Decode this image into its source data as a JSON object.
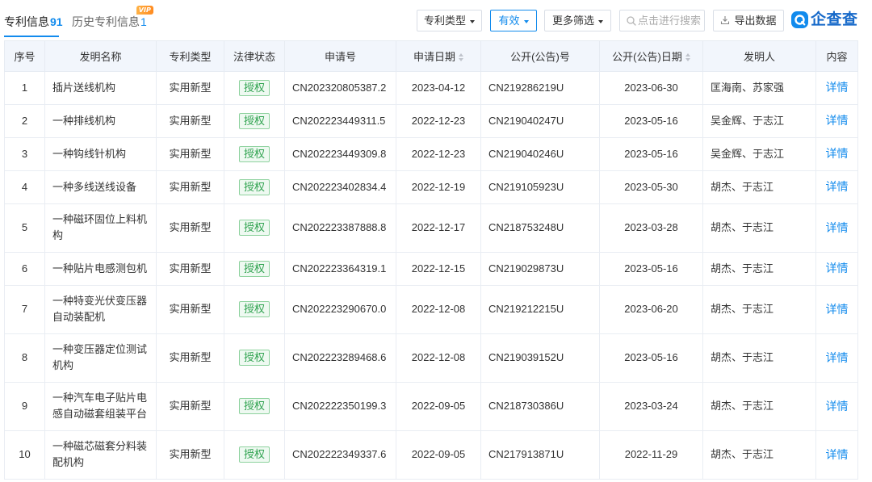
{
  "tabs": {
    "patent": {
      "label": "专利信息",
      "count": "91"
    },
    "history": {
      "label": "历史专利信息",
      "count": "1",
      "badge": "VIP"
    }
  },
  "toolbar": {
    "patent_type": "专利类型",
    "status": "有效",
    "more_filters": "更多筛选",
    "search_placeholder": "点击进行搜索",
    "export": "导出数据"
  },
  "logo": {
    "text": "企查查"
  },
  "icons": {
    "dropdown": "chevron-down-icon",
    "search": "search-icon",
    "export": "export-icon",
    "sort": "sort-icon",
    "logo": "qcc-logo-icon"
  },
  "colors": {
    "accent": "#128bed",
    "status_green": "#2fa24f",
    "vip_orange": "#ff8a1f",
    "header_bg": "#f2f6fc"
  },
  "table": {
    "columns": [
      "序号",
      "发明名称",
      "专利类型",
      "法律状态",
      "申请号",
      "申请日期",
      "公开(公告)号",
      "公开(公告)日期",
      "发明人",
      "内容"
    ],
    "rows": [
      {
        "no": "1",
        "name": "插片送线机构",
        "type": "实用新型",
        "status": "授权",
        "app_no": "CN202320805387.2",
        "app_date": "2023-04-12",
        "pub_no": "CN219286219U",
        "pub_date": "2023-06-30",
        "inventors": "匡海南、苏家强",
        "action": "详情"
      },
      {
        "no": "2",
        "name": "一种排线机构",
        "type": "实用新型",
        "status": "授权",
        "app_no": "CN202223449311.5",
        "app_date": "2022-12-23",
        "pub_no": "CN219040247U",
        "pub_date": "2023-05-16",
        "inventors": "吴金辉、于志江",
        "action": "详情"
      },
      {
        "no": "3",
        "name": "一种钩线针机构",
        "type": "实用新型",
        "status": "授权",
        "app_no": "CN202223449309.8",
        "app_date": "2022-12-23",
        "pub_no": "CN219040246U",
        "pub_date": "2023-05-16",
        "inventors": "吴金辉、于志江",
        "action": "详情"
      },
      {
        "no": "4",
        "name": "一种多线送线设备",
        "type": "实用新型",
        "status": "授权",
        "app_no": "CN202223402834.4",
        "app_date": "2022-12-19",
        "pub_no": "CN219105923U",
        "pub_date": "2023-05-30",
        "inventors": "胡杰、于志江",
        "action": "详情"
      },
      {
        "no": "5",
        "name": "一种磁环固位上料机构",
        "type": "实用新型",
        "status": "授权",
        "app_no": "CN202223387888.8",
        "app_date": "2022-12-17",
        "pub_no": "CN218753248U",
        "pub_date": "2023-03-28",
        "inventors": "胡杰、于志江",
        "action": "详情"
      },
      {
        "no": "6",
        "name": "一种贴片电感测包机",
        "type": "实用新型",
        "status": "授权",
        "app_no": "CN202223364319.1",
        "app_date": "2022-12-15",
        "pub_no": "CN219029873U",
        "pub_date": "2023-05-16",
        "inventors": "胡杰、于志江",
        "action": "详情"
      },
      {
        "no": "7",
        "name": "一种特变光伏变压器自动装配机",
        "type": "实用新型",
        "status": "授权",
        "app_no": "CN202223290670.0",
        "app_date": "2022-12-08",
        "pub_no": "CN219212215U",
        "pub_date": "2023-06-20",
        "inventors": "胡杰、于志江",
        "action": "详情"
      },
      {
        "no": "8",
        "name": "一种变压器定位测试机构",
        "type": "实用新型",
        "status": "授权",
        "app_no": "CN202223289468.6",
        "app_date": "2022-12-08",
        "pub_no": "CN219039152U",
        "pub_date": "2023-05-16",
        "inventors": "胡杰、于志江",
        "action": "详情"
      },
      {
        "no": "9",
        "name": "一种汽车电子贴片电感自动磁套组装平台",
        "type": "实用新型",
        "status": "授权",
        "app_no": "CN202222350199.3",
        "app_date": "2022-09-05",
        "pub_no": "CN218730386U",
        "pub_date": "2023-03-24",
        "inventors": "胡杰、于志江",
        "action": "详情"
      },
      {
        "no": "10",
        "name": "一种磁芯磁套分料装配机构",
        "type": "实用新型",
        "status": "授权",
        "app_no": "CN202222349337.6",
        "app_date": "2022-09-05",
        "pub_no": "CN217913871U",
        "pub_date": "2022-11-29",
        "inventors": "胡杰、于志江",
        "action": "详情"
      }
    ]
  }
}
